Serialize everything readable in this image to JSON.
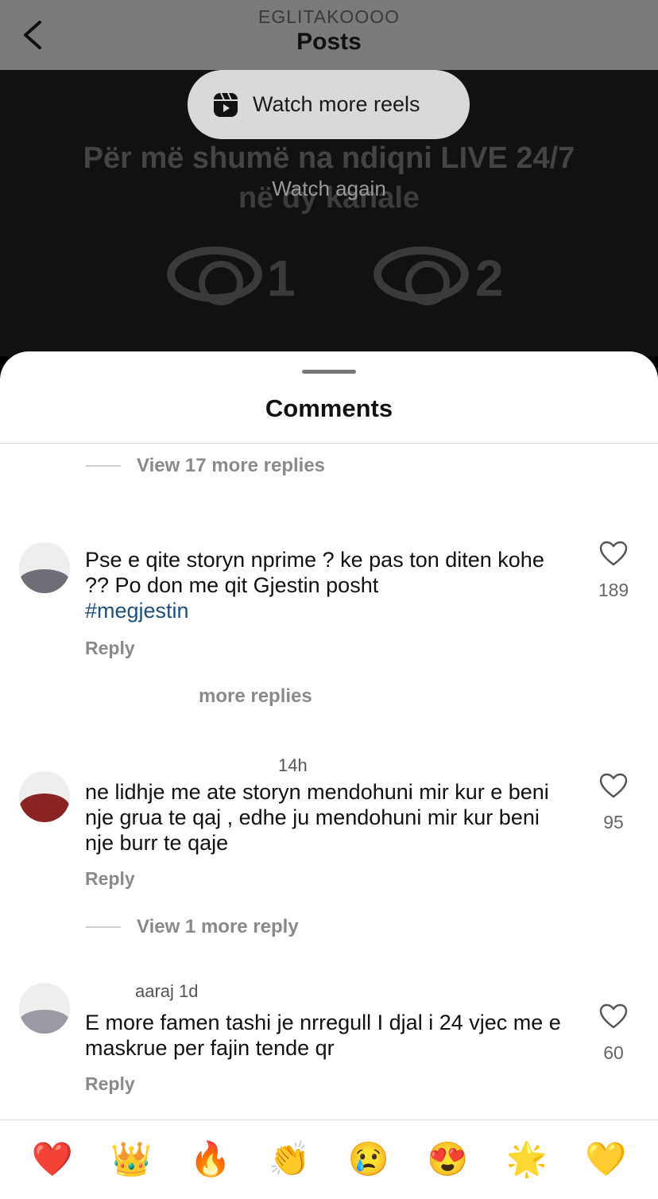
{
  "header": {
    "owner": "EGLITAKOOOO",
    "title": "Posts"
  },
  "video": {
    "bg_line1": "Për më shumë na ndiqni LIVE 24/7",
    "bg_line2": "në dy kanale",
    "channel1": "1",
    "channel2": "2",
    "watch_more_label": "Watch more reels",
    "watch_again_label": "Watch again"
  },
  "comments_sheet": {
    "title": "Comments",
    "view_replies_top": "View 17 more replies",
    "comments": [
      {
        "username": "",
        "text_main": "Pse e qite storyn nprime ? ke pas ton diten kohe ?? Po don me qit Gjestin posht",
        "hashtag": "#megjestin",
        "reply_label": "Reply",
        "likes": "189",
        "more_replies": "more replies"
      },
      {
        "username": "14h",
        "text_main": "ne lidhje me ate storyn mendohuni mir kur e beni nje grua te qaj , edhe ju mendohuni mir kur beni nje burr te qaje",
        "reply_label": "Reply",
        "likes": "95",
        "more_replies": "View 1 more reply"
      },
      {
        "username": "aaraj 1d",
        "text_main": "E more famen tashi je nrregull I djal i 24 vjec me e maskrue per fajin tende qr",
        "reply_label": "Reply",
        "likes": "60"
      }
    ]
  },
  "emoji_bar": [
    "❤️",
    "👑",
    "🔥",
    "👏",
    "😢",
    "😍",
    "🌟",
    "💛"
  ]
}
